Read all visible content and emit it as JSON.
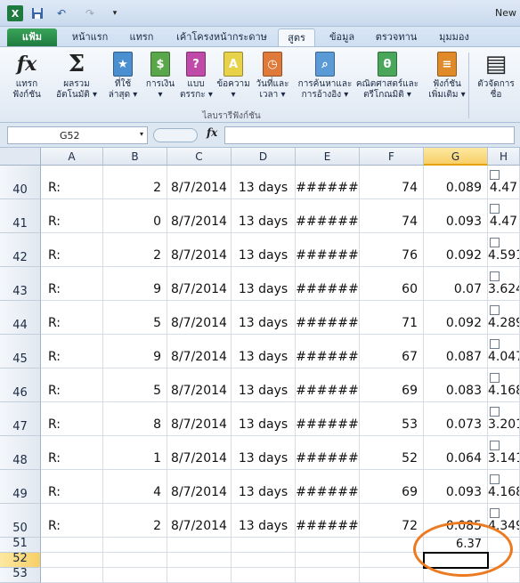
{
  "window": {
    "title": "New"
  },
  "quick_access": {
    "logo": "X",
    "save_icon": "save-icon",
    "undo_icon": "undo-icon",
    "redo_icon": "redo-icon",
    "undo_glyph": "↶",
    "redo_glyph": "↷",
    "more_glyph": "▾"
  },
  "tabs": [
    {
      "label": "แฟ้ม"
    },
    {
      "label": "หน้าแรก"
    },
    {
      "label": "แทรก"
    },
    {
      "label": "เค้าโครงหน้ากระดาษ"
    },
    {
      "label": "สูตร"
    },
    {
      "label": "ข้อมูล"
    },
    {
      "label": "ตรวจทาน"
    },
    {
      "label": "มุมมอง"
    }
  ],
  "ribbon": {
    "group_label": "ไลบรารีฟังก์ชัน",
    "buttons": [
      {
        "line1": "แทรก",
        "line2": "ฟังก์ชัน",
        "glyph": "fx",
        "icon": "insert-function-icon"
      },
      {
        "line1": "ผลรวม",
        "line2": "อัตโนมัติ ▾",
        "glyph": "Σ",
        "icon": "autosum-icon"
      },
      {
        "line1": "ที่ใช้",
        "line2": "ล่าสุด ▾",
        "glyph": "★",
        "icon": "recently-used-icon",
        "color": "#4a8fcf"
      },
      {
        "line1": "การเงิน",
        "line2": "▾",
        "glyph": "$",
        "icon": "financial-icon",
        "color": "#5aa64a"
      },
      {
        "line1": "แบบ",
        "line2": "ตรรกะ ▾",
        "glyph": "?",
        "icon": "logical-icon",
        "color": "#c04aa8"
      },
      {
        "line1": "ข้อความ",
        "line2": "▾",
        "glyph": "A",
        "icon": "text-icon",
        "color": "#e8d24a"
      },
      {
        "line1": "วันที่และ",
        "line2": "เวลา ▾",
        "glyph": "◷",
        "icon": "date-time-icon",
        "color": "#e07a3a"
      },
      {
        "line1": "การค้นหาและ",
        "line2": "การอ้างอิง ▾",
        "glyph": "⌕",
        "icon": "lookup-reference-icon",
        "color": "#5a9ad6"
      },
      {
        "line1": "คณิตศาสตร์และ",
        "line2": "ตรีโกณมิติ ▾",
        "glyph": "θ",
        "icon": "math-trig-icon",
        "color": "#4aa65a"
      },
      {
        "line1": "ฟังก์ชัน",
        "line2": "เพิ่มเติม ▾",
        "glyph": "≡",
        "icon": "more-functions-icon",
        "color": "#e08a2a"
      },
      {
        "line1": "ตัวจัดการ",
        "line2": "ชื่อ",
        "glyph": "▤",
        "icon": "name-manager-icon"
      }
    ]
  },
  "formula_bar": {
    "name_box": "G52",
    "name_box_arrow": "▾",
    "fx_label": "fx",
    "formula": ""
  },
  "columns": [
    "A",
    "B",
    "C",
    "D",
    "E",
    "F",
    "G",
    "H"
  ],
  "selected": {
    "column": "G",
    "row": "52"
  },
  "rows": [
    {
      "row": "40",
      "cells": [
        "R:",
        "2",
        "8/7/2014",
        "13 days",
        "######",
        "74",
        "0.089",
        "4.47"
      ]
    },
    {
      "row": "41",
      "cells": [
        "R:",
        "0",
        "8/7/2014",
        "13 days",
        "######",
        "74",
        "0.093",
        "4.47"
      ]
    },
    {
      "row": "42",
      "cells": [
        "R:",
        "2",
        "8/7/2014",
        "13 days",
        "######",
        "76",
        "0.092",
        "4.591"
      ]
    },
    {
      "row": "43",
      "cells": [
        "R:",
        "9",
        "8/7/2014",
        "13 days",
        "######",
        "60",
        "0.07",
        "3.624"
      ]
    },
    {
      "row": "44",
      "cells": [
        "R:",
        "5",
        "8/7/2014",
        "13 days",
        "######",
        "71",
        "0.092",
        "4.289"
      ]
    },
    {
      "row": "45",
      "cells": [
        "R:",
        "9",
        "8/7/2014",
        "13 days",
        "######",
        "67",
        "0.087",
        "4.047"
      ]
    },
    {
      "row": "46",
      "cells": [
        "R:",
        "5",
        "8/7/2014",
        "13 days",
        "######",
        "69",
        "0.083",
        "4.168"
      ]
    },
    {
      "row": "47",
      "cells": [
        "R:",
        "8",
        "8/7/2014",
        "13 days",
        "######",
        "53",
        "0.073",
        "3.201"
      ]
    },
    {
      "row": "48",
      "cells": [
        "R:",
        "1",
        "8/7/2014",
        "13 days",
        "######",
        "52",
        "0.064",
        "3.141"
      ]
    },
    {
      "row": "49",
      "cells": [
        "R:",
        "4",
        "8/7/2014",
        "13 days",
        "######",
        "69",
        "0.093",
        "4.168"
      ]
    },
    {
      "row": "50",
      "cells": [
        "R:",
        "2",
        "8/7/2014",
        "13 days",
        "######",
        "72",
        "0.085",
        "4.349"
      ]
    }
  ],
  "summary_rows": [
    {
      "row": "51",
      "g_value": "6.37"
    },
    {
      "row": "52",
      "g_value": ""
    },
    {
      "row": "53",
      "g_value": ""
    }
  ],
  "colors": {
    "accent_file_tab": "#1f7a3f",
    "selection_header": "#f7cf68",
    "highlight_oval": "#ec7a21"
  }
}
